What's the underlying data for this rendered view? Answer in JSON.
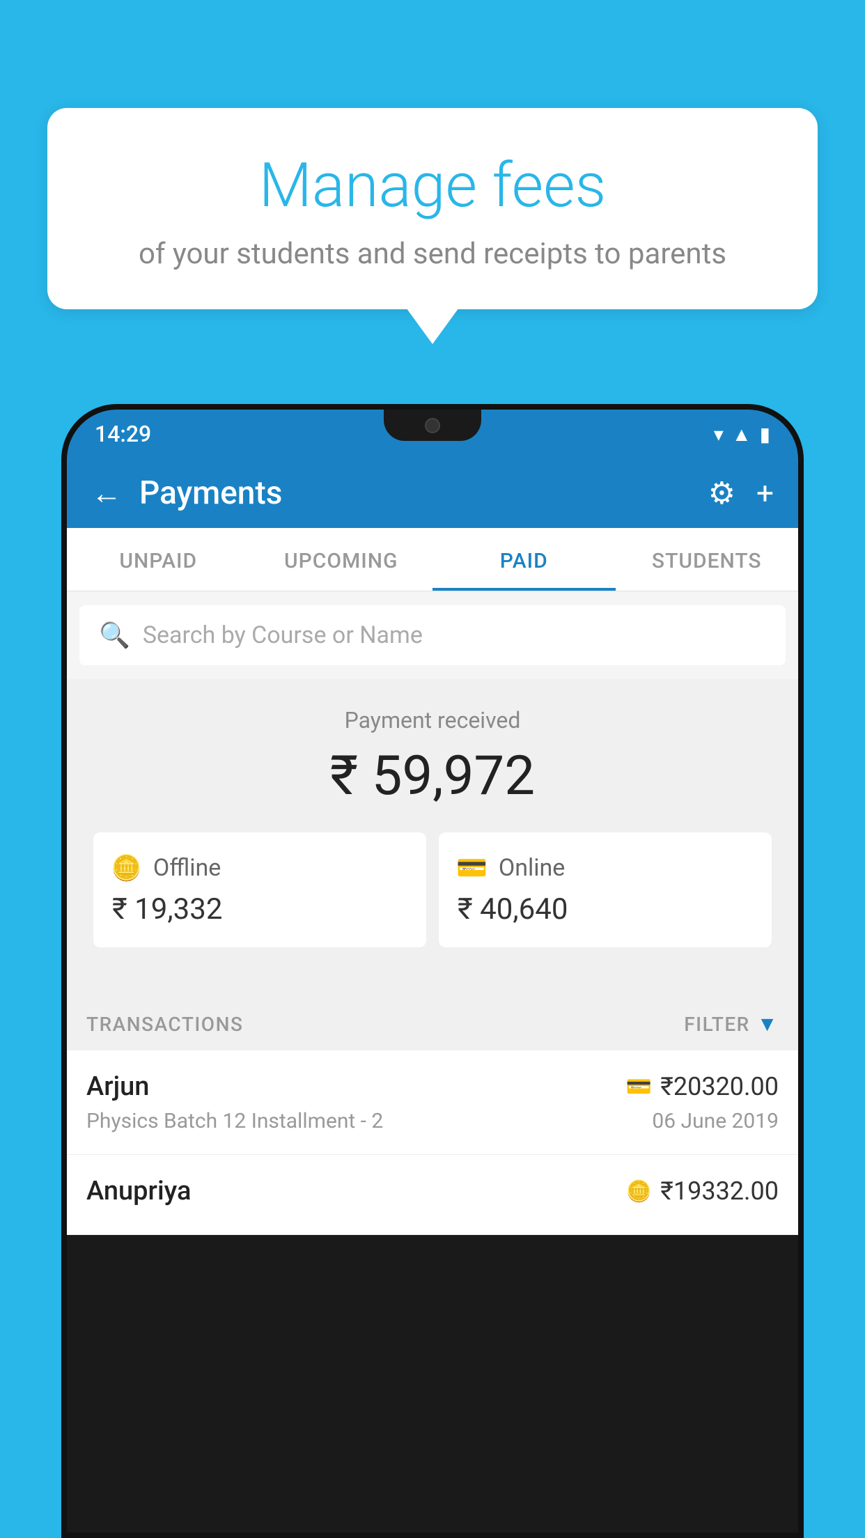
{
  "background_color": "#29b6e8",
  "bubble": {
    "title": "Manage fees",
    "subtitle": "of your students and send receipts to parents"
  },
  "phone": {
    "status_bar": {
      "time": "14:29",
      "icons": [
        "wifi",
        "signal",
        "battery"
      ]
    },
    "header": {
      "title": "Payments",
      "back_label": "←",
      "settings_icon": "⚙",
      "add_icon": "+"
    },
    "tabs": [
      {
        "label": "UNPAID",
        "active": false
      },
      {
        "label": "UPCOMING",
        "active": false
      },
      {
        "label": "PAID",
        "active": true
      },
      {
        "label": "STUDENTS",
        "active": false
      }
    ],
    "search": {
      "placeholder": "Search by Course or Name"
    },
    "payment_summary": {
      "label": "Payment received",
      "amount": "₹ 59,972",
      "offline": {
        "label": "Offline",
        "amount": "₹ 19,332"
      },
      "online": {
        "label": "Online",
        "amount": "₹ 40,640"
      }
    },
    "transactions_section": {
      "label": "TRANSACTIONS",
      "filter_label": "FILTER"
    },
    "transactions": [
      {
        "name": "Arjun",
        "course": "Physics Batch 12 Installment - 2",
        "amount": "₹20320.00",
        "date": "06 June 2019",
        "payment_type": "online"
      },
      {
        "name": "Anupriya",
        "course": "",
        "amount": "₹19332.00",
        "date": "",
        "payment_type": "offline"
      }
    ]
  }
}
